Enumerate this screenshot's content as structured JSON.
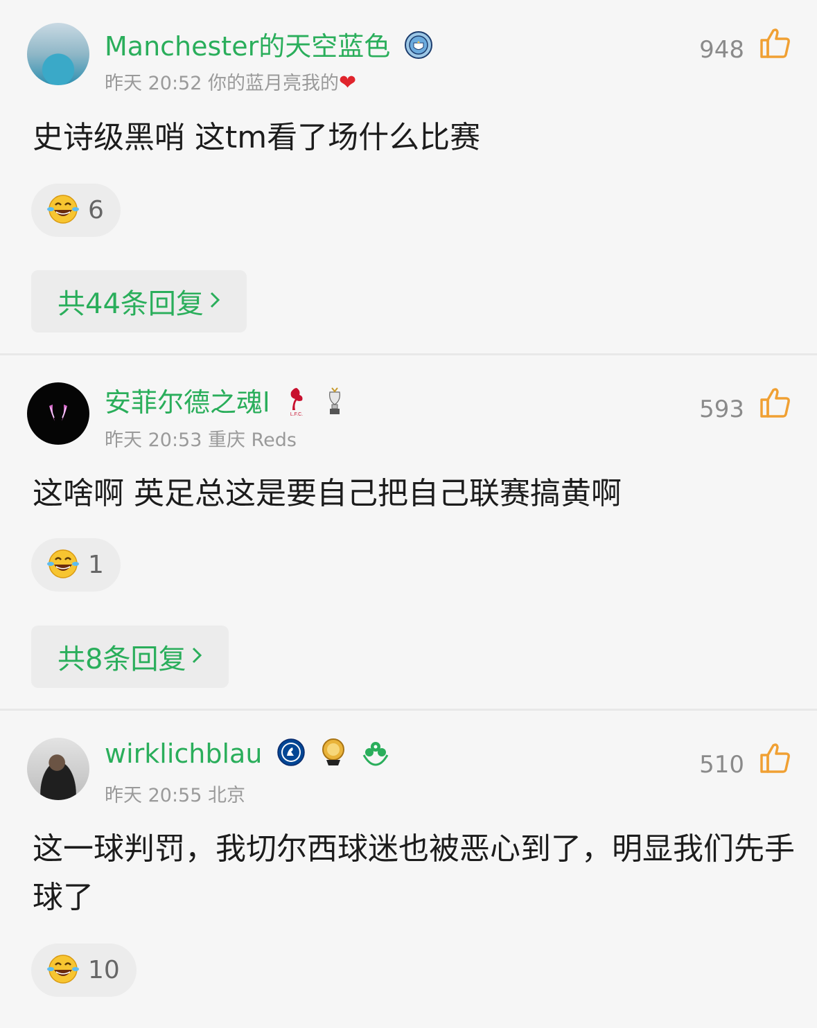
{
  "comments": [
    {
      "name": "Manchester的天空蓝色",
      "meta": "昨天 20:52 你的蓝月亮我的",
      "likes": "948",
      "text": "史诗级黑哨 这tm看了场什么比赛",
      "reaction_count": "6",
      "replies": "共44条回复"
    },
    {
      "name": "安菲尔德之魂l",
      "meta": "昨天 20:53 重庆 Reds",
      "likes": "593",
      "text": "这啥啊 英足总这是要自己把自己联赛搞黄啊",
      "reaction_count": "1",
      "replies": "共8条回复"
    },
    {
      "name": "wirklichblau",
      "meta": "昨天 20:55 北京",
      "likes": "510",
      "text": "这一球判罚，我切尔西球迷也被恶心到了，明显我们先手球了",
      "reaction_count": "10"
    }
  ],
  "colors": {
    "username": "#2aae5b",
    "like_icon": "#f0a033",
    "background": "#f6f6f6"
  },
  "icons": {
    "like": "thumbs-up-icon",
    "reaction": "laughing-tears-emoji-icon",
    "reply_arrow": "chevron-right-icon"
  },
  "badges": {
    "mci_badge_text": "MANCHESTER CITY"
  }
}
